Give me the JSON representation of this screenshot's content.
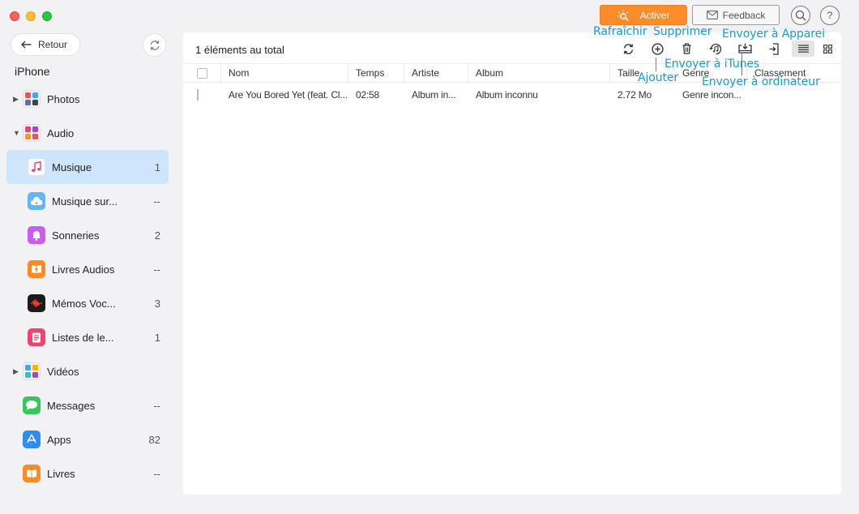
{
  "window": {
    "activate_label": "Activer",
    "feedback_label": "Feedback",
    "help_label": "?"
  },
  "nav": {
    "back_label": "Retour",
    "device_name": "iPhone"
  },
  "sidebar": {
    "items": [
      {
        "label": "Photos",
        "count": ""
      },
      {
        "label": "Audio",
        "count": ""
      },
      {
        "label": "Musique",
        "count": "1"
      },
      {
        "label": "Musique sur...",
        "count": "--"
      },
      {
        "label": "Sonneries",
        "count": "2"
      },
      {
        "label": "Livres Audios",
        "count": "--"
      },
      {
        "label": "Mémos Voc...",
        "count": "3"
      },
      {
        "label": "Listes de le...",
        "count": "1"
      },
      {
        "label": "Vidéos",
        "count": ""
      },
      {
        "label": "Messages",
        "count": "--"
      },
      {
        "label": "Apps",
        "count": "82"
      },
      {
        "label": "Livres",
        "count": "--"
      }
    ]
  },
  "main": {
    "title": "1 éléments au total",
    "columns": [
      "Nom",
      "Temps",
      "Artiste",
      "Album",
      "Taille",
      "Genre",
      "Classement"
    ],
    "rows": [
      {
        "nom": "Are You Bored Yet (feat. Cl...",
        "temps": "02:58",
        "artiste": "Album in...",
        "album": "Album inconnu",
        "taille": "2.72 Mo",
        "genre": "Genre incon...",
        "classement": ""
      }
    ]
  },
  "annotations": {
    "refresh": "Rafraîchir",
    "delete": "Supprimer",
    "to_device": "Envoyer à Apparei",
    "to_itunes": "Envoyer à iTunes",
    "add": "Ajouter",
    "to_computer": "Envoyer à ordinateur"
  },
  "colors": {
    "accent": "#fb8c2a",
    "selected": "#cde6fb",
    "annotation": "#1a9bd4"
  }
}
